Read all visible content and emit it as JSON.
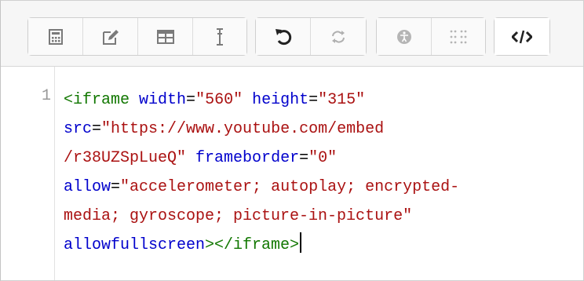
{
  "toolbar": {
    "groups": [
      {
        "buttons": [
          "calculator-icon",
          "edit-icon",
          "table-icon",
          "text-cursor-icon"
        ]
      },
      {
        "buttons": [
          "undo-icon",
          "redo-icon"
        ]
      },
      {
        "buttons": [
          "accessibility-icon",
          "braille-icon"
        ]
      },
      {
        "buttons": [
          "html-code-icon"
        ]
      }
    ]
  },
  "editor": {
    "line_number": "1",
    "tokens": {
      "t1": "<iframe",
      "t2": " ",
      "t3": "width",
      "t4": "=",
      "t5": "\"560\"",
      "t6": " ",
      "t7": "height",
      "t8": "=",
      "t9": "\"315\"",
      "t10": "src",
      "t11": "=",
      "t12": "\"https://www.youtube.com/embed",
      "t13": "/r38UZSpLueQ\"",
      "t14": " ",
      "t15": "frameborder",
      "t16": "=",
      "t17": "\"0\"",
      "t18": "allow",
      "t19": "=",
      "t20": "\"accelerometer; autoplay; encrypted-",
      "t21": "media; gyroscope; picture-in-picture\"",
      "t22": "allowfullscreen",
      "t23": "></iframe>"
    }
  }
}
